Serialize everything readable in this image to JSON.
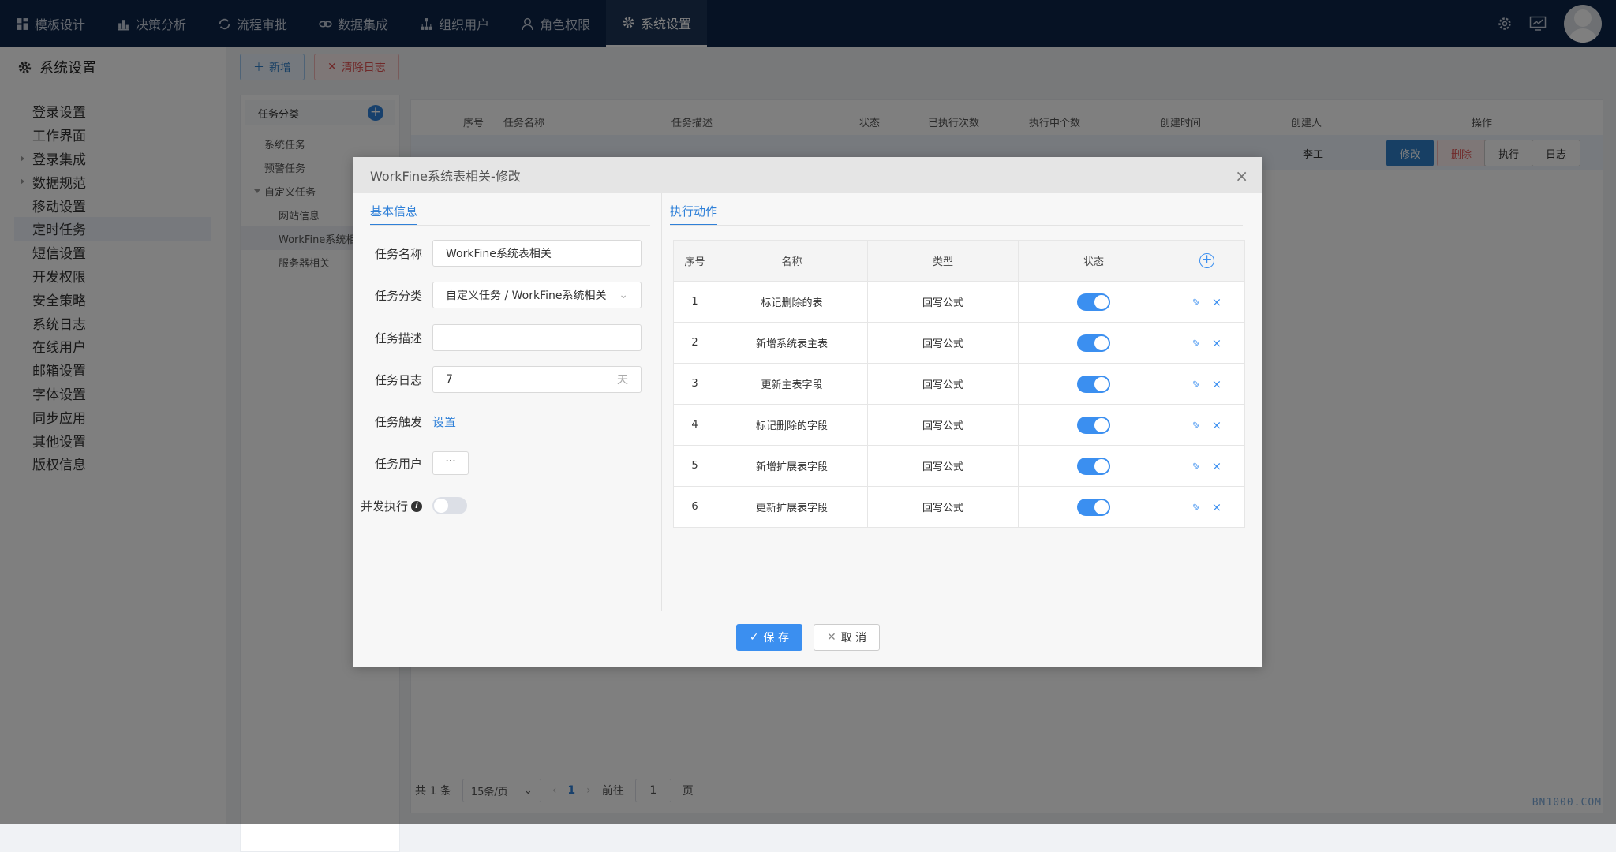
{
  "nav": {
    "items": [
      {
        "label": "模板设计",
        "icon": "grid-icon"
      },
      {
        "label": "决策分析",
        "icon": "bar-chart-icon"
      },
      {
        "label": "流程审批",
        "icon": "refresh-icon"
      },
      {
        "label": "数据集成",
        "icon": "link-icon"
      },
      {
        "label": "组织用户",
        "icon": "org-chart-icon"
      },
      {
        "label": "角色权限",
        "icon": "user-icon"
      },
      {
        "label": "系统设置",
        "icon": "gear-icon"
      }
    ],
    "active_index": 6
  },
  "sidebar": {
    "title": "系统设置",
    "items": [
      "登录设置",
      "工作界面",
      "登录集成",
      "数据规范",
      "移动设置",
      "定时任务",
      "短信设置",
      "开发权限",
      "安全策略",
      "系统日志",
      "在线用户",
      "邮箱设置",
      "字体设置",
      "同步应用",
      "其他设置",
      "版权信息"
    ],
    "active_label": "定时任务"
  },
  "toolbar": {
    "add_label": "新增",
    "clear_label": "清除日志"
  },
  "tree": {
    "header": "任务分类",
    "nodes": {
      "system": "系统任务",
      "warning": "预警任务",
      "custom": "自定义任务",
      "site": "网站信息",
      "workfine": "WorkFine系统相关",
      "server": "服务器相关"
    }
  },
  "grid": {
    "columns": {
      "seq": "序号",
      "name": "任务名称",
      "desc": "任务描述",
      "status": "状态",
      "executed": "已执行次数",
      "running": "执行中个数",
      "created": "创建时间",
      "creator": "创建人",
      "ops": "操作"
    },
    "row": {
      "creator": "李工"
    },
    "row_buttons": {
      "edit": "修改",
      "delete": "删除",
      "run": "执行",
      "log": "日志"
    }
  },
  "pager": {
    "total": "共 1 条",
    "page_size": "15条/页",
    "current": "1",
    "goto_prefix": "前往",
    "goto_value": "1",
    "goto_suffix": "页"
  },
  "watermark": "BN1000.COM",
  "modal": {
    "title": "WorkFine系统表相关-修改",
    "left_tab": "基本信息",
    "right_tab": "执行动作",
    "form": {
      "name_label": "任务名称",
      "name_value": "WorkFine系统表相关",
      "category_label": "任务分类",
      "category_value": "自定义任务 / WorkFine系统相关",
      "desc_label": "任务描述",
      "desc_value": "",
      "log_label": "任务日志",
      "log_value": "7",
      "log_unit": "天",
      "trigger_label": "任务触发",
      "trigger_link": "设置",
      "user_label": "任务用户",
      "user_button": "···",
      "concurrent_label": "并发执行",
      "concurrent_on": false
    },
    "actions": {
      "headers": {
        "seq": "序号",
        "name": "名称",
        "type": "类型",
        "status": "状态"
      },
      "rows": [
        {
          "seq": "1",
          "name": "标记删除的表",
          "type": "回写公式",
          "enabled": true
        },
        {
          "seq": "2",
          "name": "新增系统表主表",
          "type": "回写公式",
          "enabled": true
        },
        {
          "seq": "3",
          "name": "更新主表字段",
          "type": "回写公式",
          "enabled": true
        },
        {
          "seq": "4",
          "name": "标记删除的字段",
          "type": "回写公式",
          "enabled": true
        },
        {
          "seq": "5",
          "name": "新增扩展表字段",
          "type": "回写公式",
          "enabled": true
        },
        {
          "seq": "6",
          "name": "更新扩展表字段",
          "type": "回写公式",
          "enabled": true
        }
      ]
    },
    "save_label": "保 存",
    "cancel_label": "取 消"
  },
  "colors": {
    "topbar": "#0c2549",
    "accent": "#3b8ff0",
    "danger": "#e05252"
  }
}
